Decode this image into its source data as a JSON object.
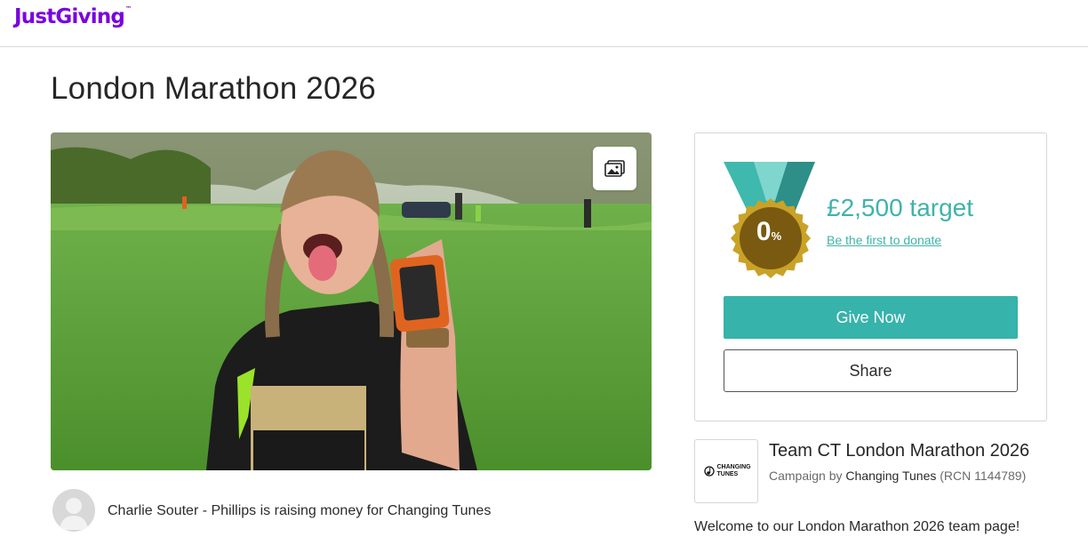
{
  "header": {
    "logo_text": "JustGiving",
    "logo_tm": "™",
    "logo_color": "#7a04dd"
  },
  "page": {
    "title": "London Marathon 2026"
  },
  "hero": {
    "gallery_icon": "image-gallery-icon"
  },
  "owner": {
    "text": "Charlie Souter - Phillips is raising money for Changing Tunes"
  },
  "donation": {
    "progress_percent": 0,
    "percent_value": "0",
    "percent_sign": "%",
    "target": "£2,500 target",
    "first_donate_link": "Be the first to donate",
    "give_label": "Give Now",
    "share_label": "Share",
    "accent_color": "#36b3aa",
    "medal_gold": "#c9a227",
    "medal_inner": "#7a5a10"
  },
  "team": {
    "logo_text": "CHANGING TUNES",
    "name": "Team CT London Marathon 2026",
    "campaign_by": "Campaign by",
    "charity": "Changing Tunes",
    "rcn": "(RCN 1144789)"
  },
  "description": {
    "welcome": "Welcome to our London Marathon 2026 team page!"
  }
}
